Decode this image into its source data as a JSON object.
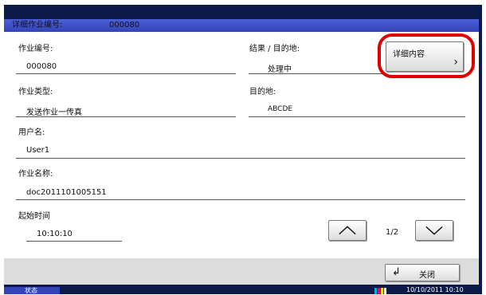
{
  "title_bar": {
    "label": "详细作业编号:",
    "job_number": "000080"
  },
  "fields": {
    "job_number": {
      "label": "作业编号:",
      "value": "000080"
    },
    "job_type": {
      "label": "作业类型:",
      "value": "发送作业一传真"
    },
    "user_name": {
      "label": "用户名:",
      "value": "User1"
    },
    "job_name": {
      "label": "作业名称:",
      "value": "doc2011101005151"
    },
    "start_time": {
      "label": "起始时间",
      "value": "10:10:10"
    },
    "result": {
      "label": "结果 / 目的地:",
      "value": "处理中"
    },
    "destination": {
      "label": "目的地:",
      "value": "ABCDE"
    }
  },
  "buttons": {
    "detail": "详细内容",
    "close": "关闭"
  },
  "pager": {
    "indicator": "1/2"
  },
  "status_bar": {
    "status_label": "状态",
    "datetime": "10/10/2011   10:10"
  },
  "colors": {
    "title_bar": "#3344b8",
    "frame": "#0c1a4a",
    "highlight": "#e00000",
    "bottom_bar": "#dcdcdc"
  }
}
